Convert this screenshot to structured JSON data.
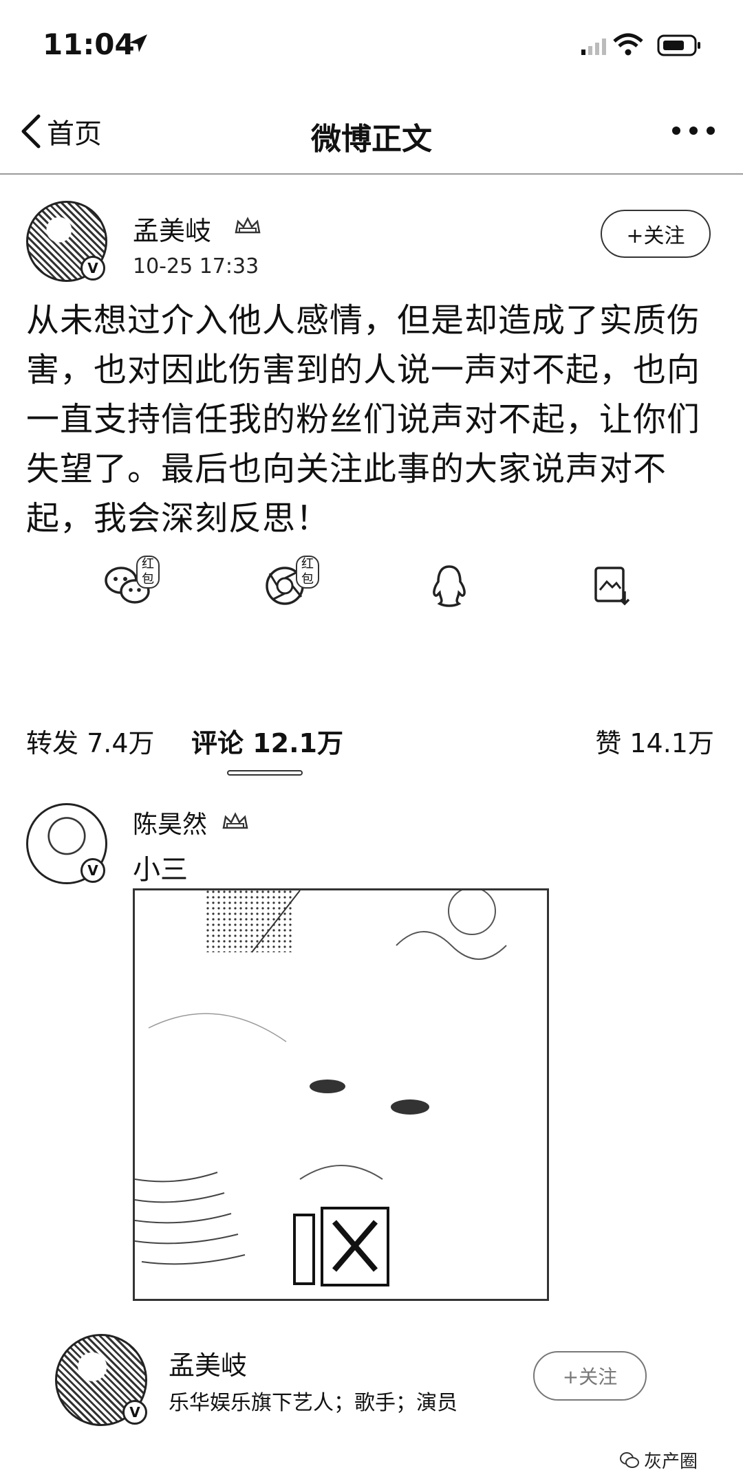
{
  "status_bar": {
    "time": "11:04"
  },
  "nav": {
    "back_label": "首页",
    "title": "微博正文"
  },
  "post": {
    "author": "孟美岐",
    "time": "10-25 17:33",
    "follow_label": "+关注",
    "badge": "V",
    "body": "从未想过介入他人感情，但是却造成了实质伤害，也对因此伤害到的人说一声对不起，也向一直支持信任我的粉丝们说声对不起，让你们失望了。最后也向关注此事的大家说声对不起，我会深刻反思！"
  },
  "share": {
    "wechat_pill": "红包",
    "moments_pill": "红包",
    "icons": [
      "wechat-icon",
      "moments-icon",
      "qq-icon",
      "save-image-icon"
    ]
  },
  "tabs": {
    "repost": "转发 7.4万",
    "comment": "评论 12.1万",
    "like": "赞 14.1万"
  },
  "comment": {
    "author": "陈昊然",
    "text": "小三",
    "badge": "V",
    "image_caption": "呕"
  },
  "account_card": {
    "name": "孟美岐",
    "desc": "乐华娱乐旗下艺人；歌手；演员",
    "follow_label": "+关注",
    "badge": "V"
  },
  "watermark": {
    "text": "灰产圈"
  },
  "colors": {
    "text": "#111111",
    "border": "#333333",
    "muted": "#777777",
    "background": "#ffffff"
  }
}
